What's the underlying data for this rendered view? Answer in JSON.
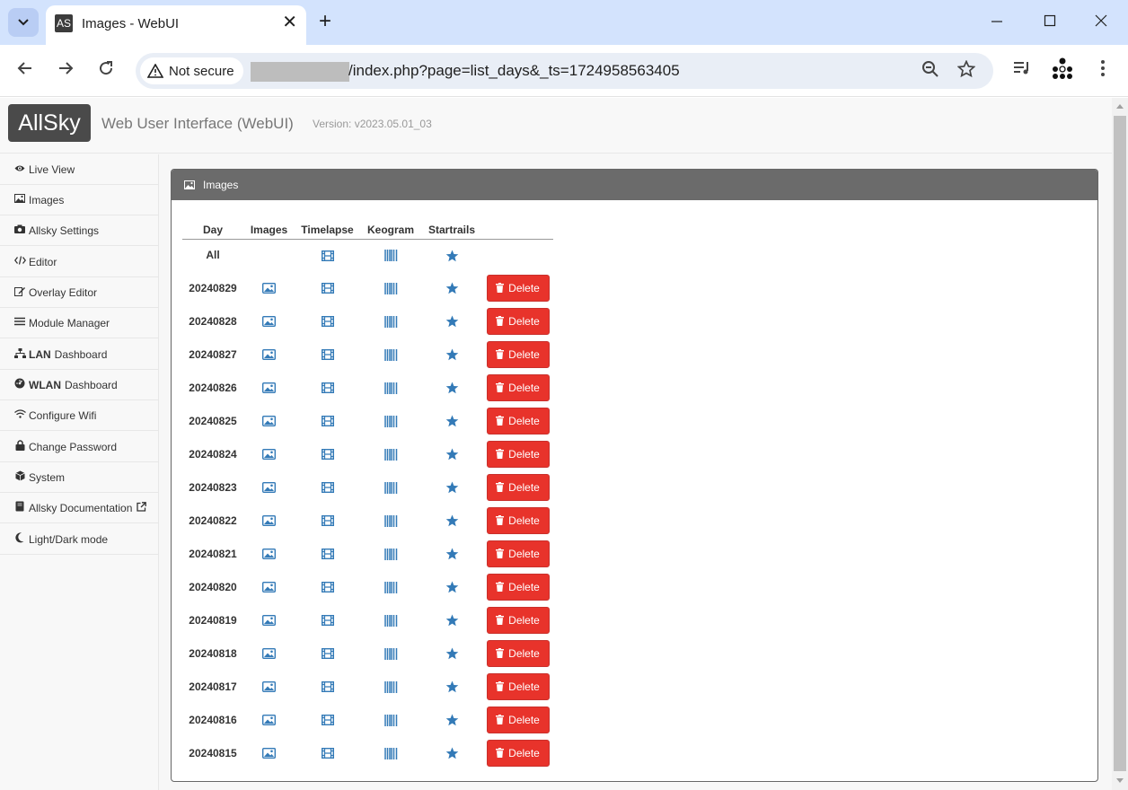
{
  "browser": {
    "tab_favicon": "AS",
    "tab_title": "Images - WebUI",
    "security_label": "Not secure",
    "url_visible": "/index.php?page=list_days&_ts=1724958563405"
  },
  "header": {
    "logo": "AllSky",
    "app_title": "Web User Interface (WebUI)",
    "version": "Version: v2023.05.01_03"
  },
  "sidebar": {
    "items": [
      {
        "icon": "eye-icon",
        "bold": "",
        "label": "Live View"
      },
      {
        "icon": "image-icon",
        "bold": "",
        "label": "Images"
      },
      {
        "icon": "camera-icon",
        "bold": "",
        "label": "Allsky Settings"
      },
      {
        "icon": "code-icon",
        "bold": "",
        "label": "Editor"
      },
      {
        "icon": "edit-icon",
        "bold": "",
        "label": "Overlay Editor"
      },
      {
        "icon": "list-icon",
        "bold": "",
        "label": "Module Manager"
      },
      {
        "icon": "network-icon",
        "bold": "LAN",
        "label": "Dashboard"
      },
      {
        "icon": "dashboard-icon",
        "bold": "WLAN",
        "label": "Dashboard"
      },
      {
        "icon": "wifi-icon",
        "bold": "",
        "label": "Configure Wifi"
      },
      {
        "icon": "lock-icon",
        "bold": "",
        "label": "Change Password"
      },
      {
        "icon": "cube-icon",
        "bold": "",
        "label": "System"
      },
      {
        "icon": "book-icon",
        "bold": "",
        "label": "Allsky Documentation"
      },
      {
        "icon": "moon-icon",
        "bold": "",
        "label": "Light/Dark mode"
      }
    ]
  },
  "panel": {
    "title": "Images",
    "columns": [
      "Day",
      "Images",
      "Timelapse",
      "Keogram",
      "Startrails"
    ],
    "all_label": "All",
    "delete_label": "Delete",
    "days": [
      "20240829",
      "20240828",
      "20240827",
      "20240826",
      "20240825",
      "20240824",
      "20240823",
      "20240822",
      "20240821",
      "20240820",
      "20240819",
      "20240818",
      "20240817",
      "20240816",
      "20240815"
    ]
  },
  "colors": {
    "icon_blue": "#337ab7",
    "delete_red": "#e8332b",
    "panel_header": "#6b6b6b"
  }
}
